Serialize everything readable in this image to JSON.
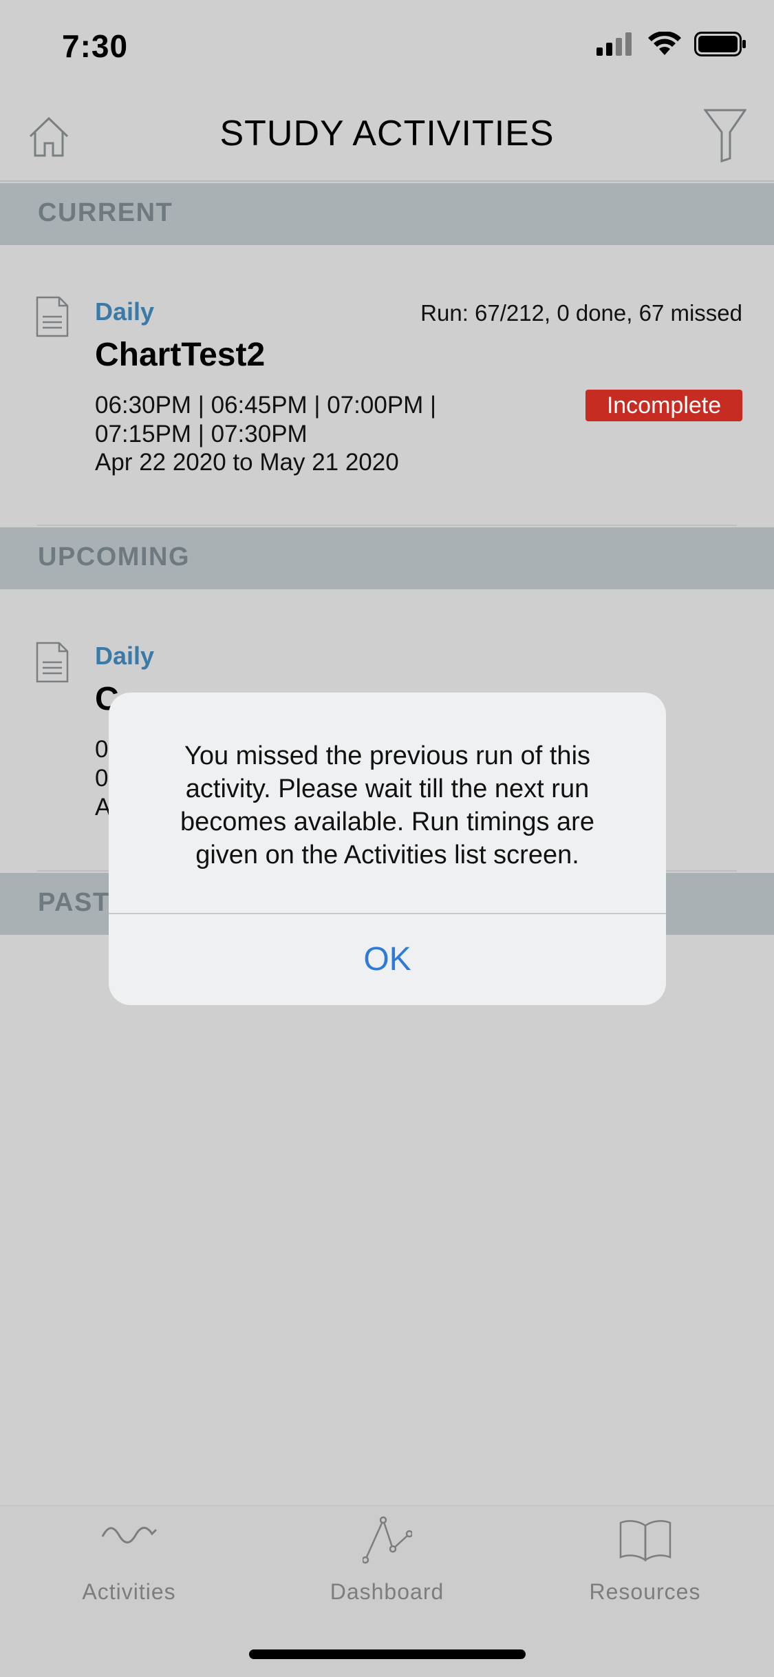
{
  "status": {
    "time": "7:30"
  },
  "nav": {
    "title": "STUDY ACTIVITIES"
  },
  "sections": {
    "current": "CURRENT",
    "upcoming": "UPCOMING",
    "past": "PAST"
  },
  "current_activity": {
    "frequency": "Daily",
    "run_info": "Run: 67/212, 0 done, 67 missed",
    "title": "ChartTest2",
    "times_line1": "06:30PM | 06:45PM | 07:00PM |",
    "times_line2": "07:15PM | 07:30PM",
    "dates": "Apr 22 2020 to May 21 2020",
    "status": "Incomplete"
  },
  "upcoming_activity": {
    "frequency": "Daily",
    "title": "C",
    "line1": "0",
    "line2": "0",
    "line3": "A"
  },
  "alert": {
    "message": "You missed the previous run of this activity. Please wait till the next run becomes available. Run timings are given on the Activities list screen.",
    "ok_label": "OK"
  },
  "tabs": [
    {
      "label": "Activities"
    },
    {
      "label": "Dashboard"
    },
    {
      "label": "Resources"
    }
  ],
  "colors": {
    "accent_blue": "#3a7aa8",
    "badge_red": "#c72c23",
    "alert_button": "#2f7ad8"
  }
}
